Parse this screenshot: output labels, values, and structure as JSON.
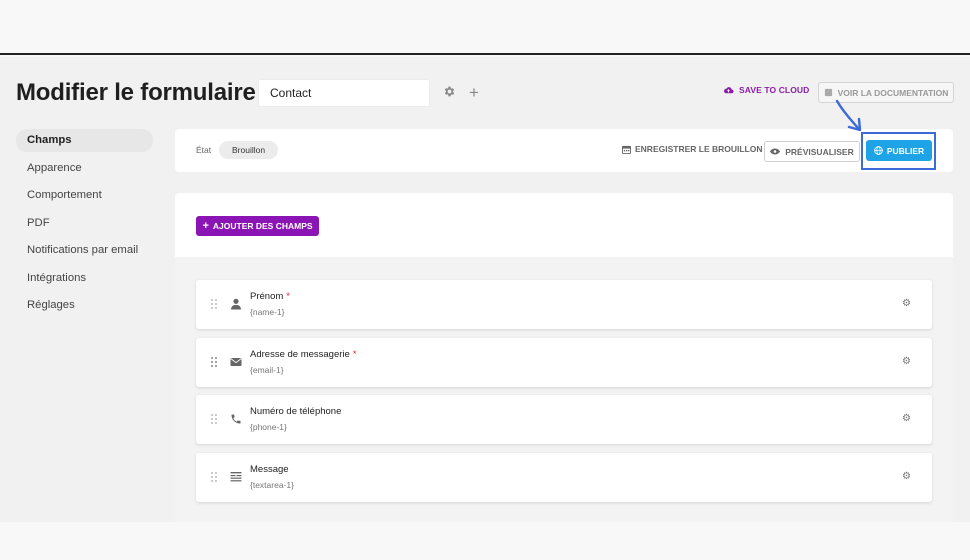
{
  "header": {
    "title": "Modifier le formulaire",
    "form_name": "Contact",
    "save_cloud_label": "SAVE TO CLOUD",
    "docs_label": "VOIR LA DOCUMENTATION"
  },
  "sidebar": {
    "items": [
      {
        "label": "Champs",
        "active": true
      },
      {
        "label": "Apparence"
      },
      {
        "label": "Comportement"
      },
      {
        "label": "PDF"
      },
      {
        "label": "Notifications par email"
      },
      {
        "label": "Intégrations"
      },
      {
        "label": "Réglages"
      }
    ]
  },
  "status_bar": {
    "state_label": "État",
    "state_value": "Brouillon",
    "save_draft_label": "ENREGISTRER LE BROUILLON",
    "preview_label": "PRÉVISUALISER",
    "publish_label": "PUBLIER"
  },
  "content": {
    "add_fields_label": "AJOUTER DES CHAMPS",
    "fields": [
      {
        "label": "Prénom",
        "required": "*",
        "name": "{name-1}",
        "icon": "person-icon"
      },
      {
        "label": "Adresse de messagerie",
        "required": "*",
        "name": "{email-1}",
        "icon": "envelope-icon"
      },
      {
        "label": "Numéro de téléphone",
        "required": "",
        "name": "{phone-1}",
        "icon": "phone-icon"
      },
      {
        "label": "Message",
        "required": "",
        "name": "{textarea-1}",
        "icon": "textarea-icon"
      }
    ]
  },
  "colors": {
    "accent_purple": "#8b14b4",
    "publish_blue": "#1ea3e6",
    "highlight_outline": "#3d6ad8",
    "required_red": "#d9263a"
  }
}
